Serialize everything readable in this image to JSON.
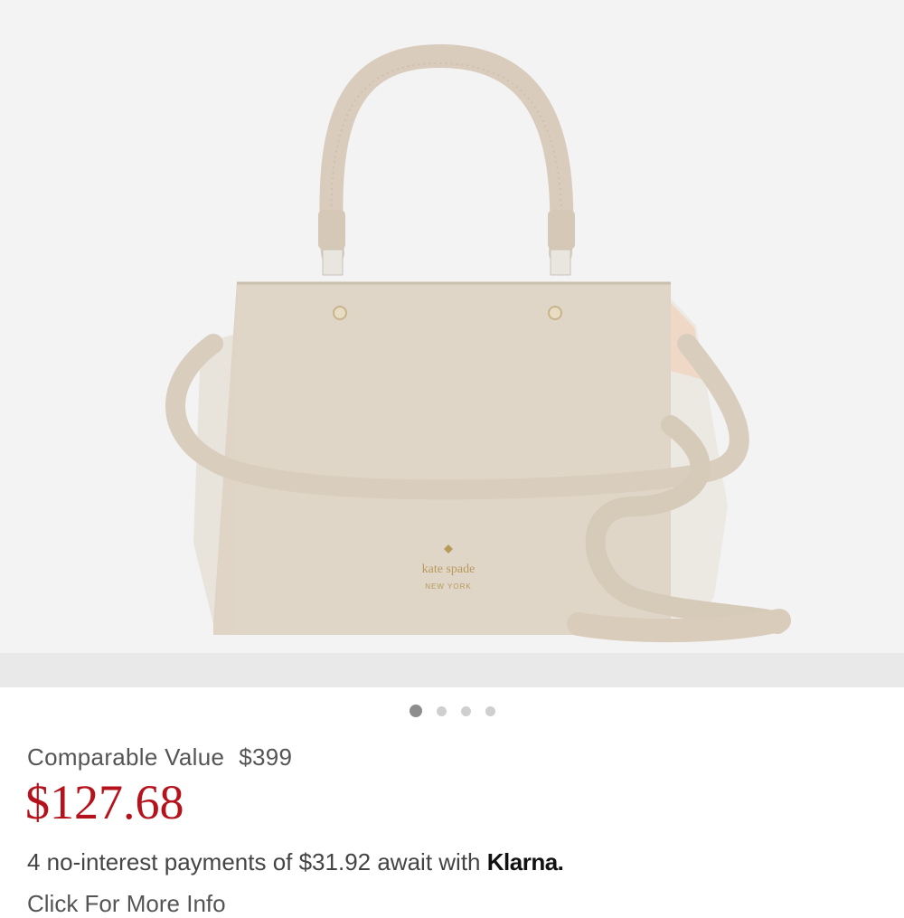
{
  "product": {
    "image_alt": "kate spade new york satchel handbag",
    "logo_line1": "kate spade",
    "logo_line2": "NEW YORK"
  },
  "carousel": {
    "total": 4,
    "active_index": 0
  },
  "pricing": {
    "comparable_label": "Comparable Value",
    "comparable_value": "$399",
    "sale_price": "$127.68",
    "sale_price_color": "#b5121b",
    "payments_text": "4 no-interest payments of $31.92 await with",
    "klarna_label": "Klarna.",
    "more_info_label": "Click For More Info"
  }
}
